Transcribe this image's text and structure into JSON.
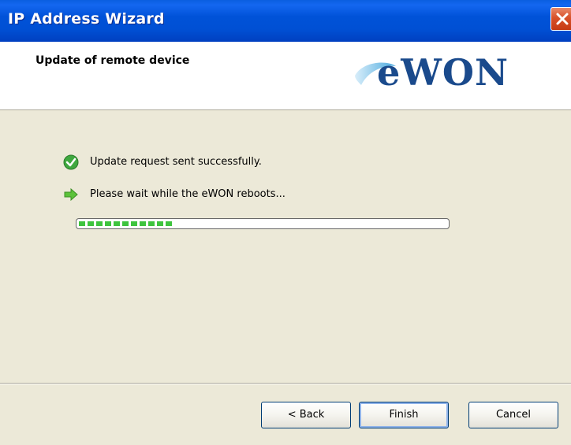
{
  "window": {
    "title": "IP Address Wizard",
    "close_icon": "close-icon"
  },
  "header": {
    "title": "Update of remote device",
    "logo_text": "eWON",
    "logo_icon": "ewon-swoosh-logo"
  },
  "content": {
    "lines": [
      {
        "icon": "success-check-icon",
        "text": "Update request sent successfully."
      },
      {
        "icon": "arrow-right-icon",
        "text": "Please wait while the eWON reboots..."
      }
    ],
    "progress": 0.26
  },
  "buttons": {
    "back": "< Back",
    "finish": "Finish",
    "cancel": "Cancel"
  },
  "colors": {
    "titlebar": "#0052d8",
    "progress_fill": "#3ec43e",
    "logo": "#1a4a8c"
  }
}
